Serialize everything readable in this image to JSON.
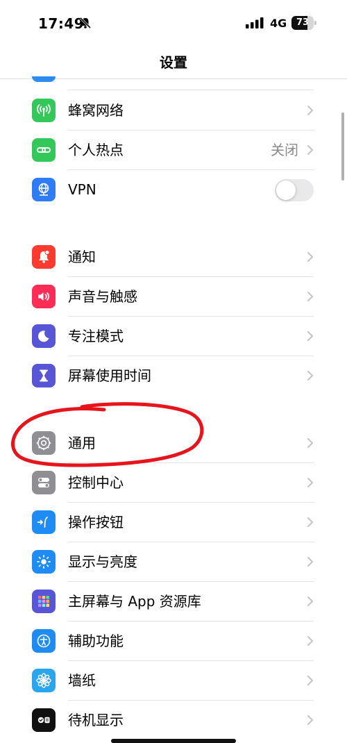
{
  "status_bar": {
    "time": "17:49",
    "network": "4G",
    "battery_level": "73",
    "battery_fraction": 0.73,
    "icons": [
      "bell-slash-icon",
      "signal-bars-icon",
      "battery-icon"
    ]
  },
  "nav": {
    "title": "设置"
  },
  "rows": {
    "cellular": {
      "label": "蜂窝网络",
      "icon": "antenna-icon",
      "color": "#34c759"
    },
    "hotspot": {
      "label": "个人热点",
      "value": "关闭",
      "icon": "hotspot-link-icon",
      "color": "#34c759"
    },
    "vpn": {
      "label": "VPN",
      "icon": "vpn-globe-icon",
      "color": "#2e7cf6",
      "toggle_on": false
    },
    "notifications": {
      "label": "通知",
      "icon": "bell-icon",
      "color": "#ff3b30"
    },
    "sounds": {
      "label": "声音与触感",
      "icon": "speaker-icon",
      "color": "#ff2d55"
    },
    "focus": {
      "label": "专注模式",
      "icon": "moon-icon",
      "color": "#5856d6"
    },
    "screen_time": {
      "label": "屏幕使用时间",
      "icon": "hourglass-icon",
      "color": "#5856d6"
    },
    "general": {
      "label": "通用",
      "icon": "gear-icon",
      "color": "#8e8e93"
    },
    "control_center": {
      "label": "控制中心",
      "icon": "toggles-icon",
      "color": "#8e8e93"
    },
    "action_button": {
      "label": "操作按钮",
      "icon": "action-arrow-icon",
      "color": "#1f8cf5"
    },
    "display": {
      "label": "显示与亮度",
      "icon": "sun-icon",
      "color": "#1f8cf5"
    },
    "home_screen": {
      "label": "主屏幕与 App 资源库",
      "icon": "app-grid-icon",
      "color": "#5856d6"
    },
    "accessibility": {
      "label": "辅助功能",
      "icon": "accessibility-icon",
      "color": "#1f8cf5"
    },
    "wallpaper": {
      "label": "墙纸",
      "icon": "flower-icon",
      "color": "#2aa6f0"
    },
    "standby": {
      "label": "待机显示",
      "icon": "standby-icon",
      "color": "#111111"
    }
  },
  "annotation": {
    "color": "#e8141c",
    "target": "general"
  }
}
